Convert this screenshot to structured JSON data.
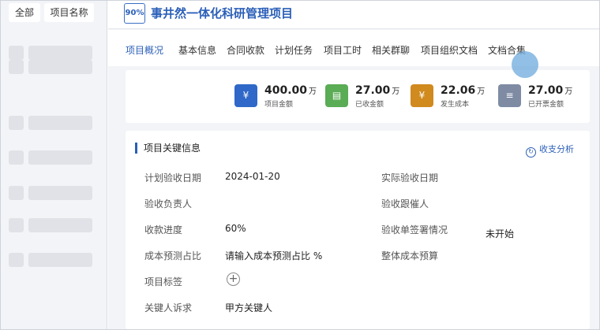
{
  "sidebar": {
    "tabs": [
      "全部",
      "项目名称"
    ]
  },
  "header": {
    "progress_badge": "90%",
    "title": "事井然一体化科研管理项目"
  },
  "tabs": [
    "项目概况",
    "基本信息",
    "合同收款",
    "计划任务",
    "项目工时",
    "相关群聊",
    "项目组织文档",
    "文档合集"
  ],
  "active_tab": "项目概况",
  "stats": [
    {
      "value": "400.00",
      "unit": "万",
      "label": "项目金额",
      "icon": "yen-document-icon",
      "color": "#2f68c8"
    },
    {
      "value": "27.00",
      "unit": "万",
      "label": "已收金额",
      "icon": "wallet-icon",
      "color": "#5aac55"
    },
    {
      "value": "22.06",
      "unit": "万",
      "label": "发生成本",
      "icon": "yen-receipt-icon",
      "color": "#d08a1e"
    },
    {
      "value": "27.00",
      "unit": "万",
      "label": "已开票金额",
      "icon": "invoice-icon",
      "color": "#7e8ba3"
    }
  ],
  "info": {
    "section_title": "项目关键信息",
    "analysis_link": "收支分析",
    "fields": {
      "planned_acceptance_date_label": "计划验收日期",
      "planned_acceptance_date_value": "2024-01-20",
      "actual_acceptance_date_label": "实际验收日期",
      "acceptance_owner_label": "验收负责人",
      "acceptance_follower_label": "验收跟催人",
      "collection_progress_label": "收款进度",
      "collection_progress_value": "60%",
      "acceptance_sign_label": "验收单签署情况",
      "acceptance_sign_value": "未开始",
      "cost_forecast_ratio_label": "成本预测占比",
      "cost_forecast_ratio_value": "请输入成本预测占比 %",
      "total_cost_budget_label": "整体成本预算",
      "project_tags_label": "项目标签",
      "key_person_label": "关键人诉求",
      "key_person_value": "甲方关键人"
    }
  }
}
